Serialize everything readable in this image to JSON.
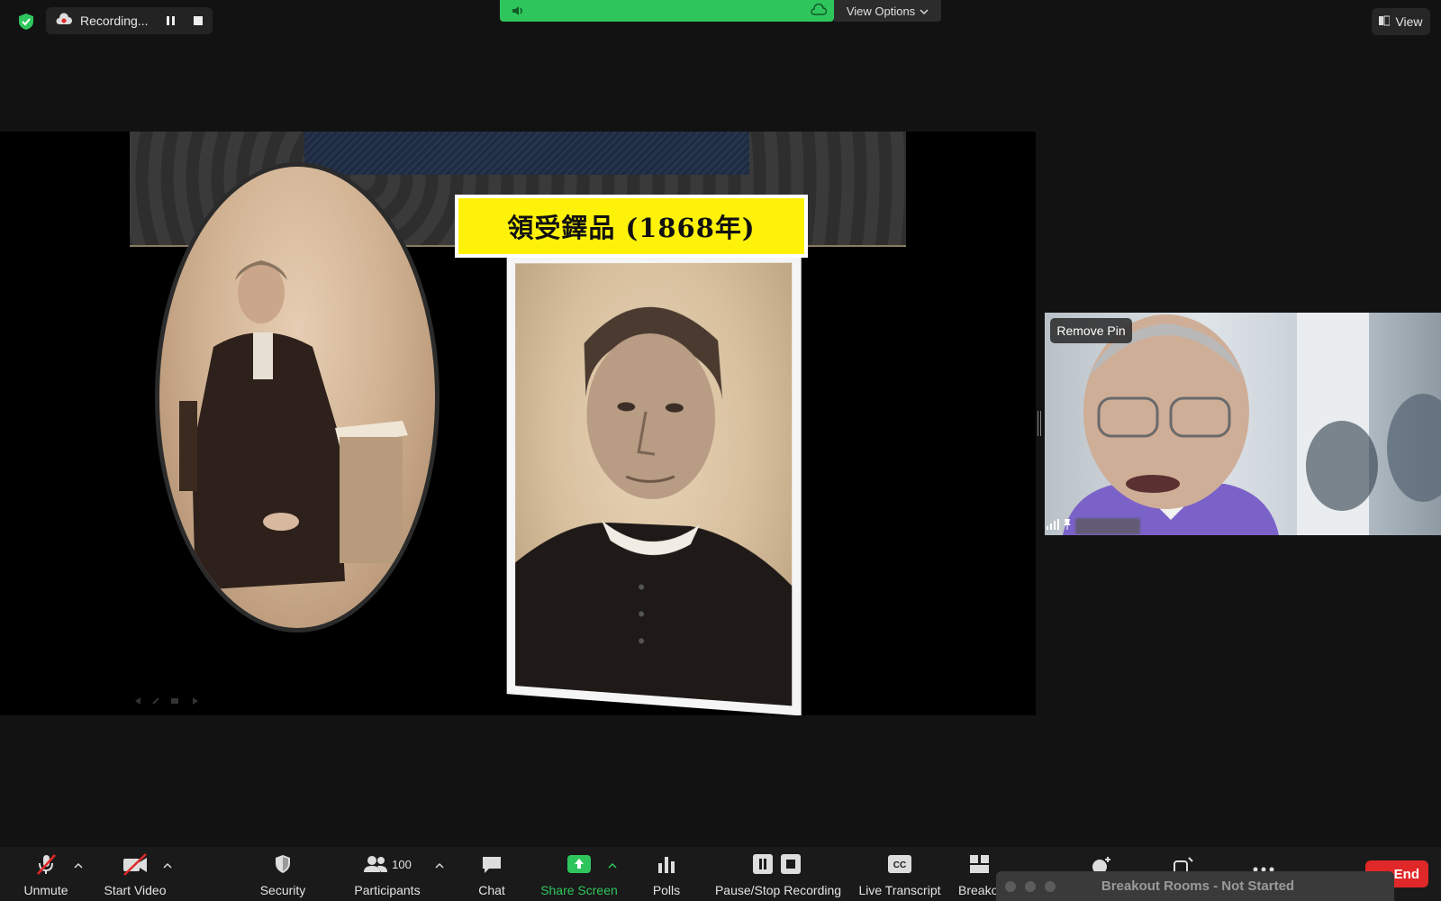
{
  "top": {
    "recording_label": "Recording...",
    "view_options_label": "View Options",
    "view_label": "View"
  },
  "slide": {
    "title": "領受鐸品 (1868年)"
  },
  "video": {
    "remove_pin_label": "Remove Pin"
  },
  "toolbar": {
    "unmute": "Unmute",
    "start_video": "Start Video",
    "security": "Security",
    "participants": "Participants",
    "participants_count": "100",
    "chat": "Chat",
    "share_screen": "Share Screen",
    "polls": "Polls",
    "pause_stop_recording": "Pause/Stop Recording",
    "live_transcript": "Live Transcript",
    "breakout": "Breako",
    "end": "End"
  },
  "breakout": {
    "title": "Breakout Rooms - Not Started"
  },
  "colors": {
    "share_green": "#2ec65c",
    "end_red": "#e02828",
    "slide_title_yellow": "#fff20a"
  }
}
